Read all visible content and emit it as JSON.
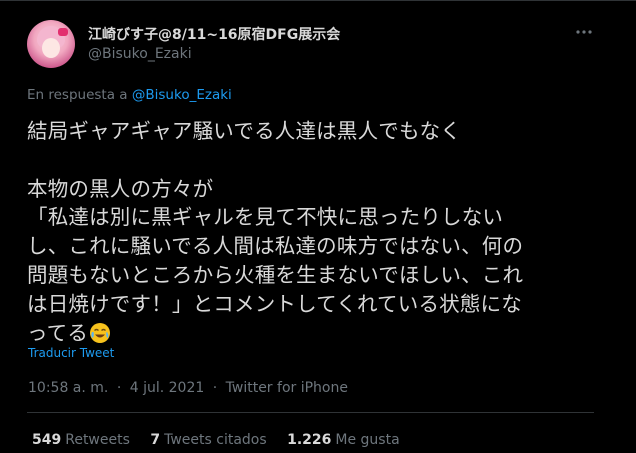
{
  "author": {
    "display_name": "江崎びす子@8/11~16原宿DFG展示会",
    "handle": "@Bisuko_Ezaki"
  },
  "reply": {
    "prefix": "En respuesta a",
    "mention": "@Bisuko_Ezaki"
  },
  "tweet": {
    "text": "結局ギャアギャア騒いでる人達は黒人でもなく\n\n本物の黒人の方々が\n「私達は別に黒ギャルを見て不快に思ったりしない\nし、これに騒いでる人間は私達の味方ではない、何の\n問題もないところから火種を生まないでほしい、これ\nは日焼けです！」とコメントしてくれている状態にな\nってる",
    "emoji": "face-with-tears-of-joy-icon"
  },
  "translate_label": "Traducir Tweet",
  "meta": {
    "time": "10:58 a. m.",
    "separator": "·",
    "date": "4 jul. 2021",
    "source": "Twitter for iPhone"
  },
  "stats": {
    "retweets_count": "549",
    "retweets_label": "Retweets",
    "quotes_count": "7",
    "quotes_label": "Tweets citados",
    "likes_count": "1.226",
    "likes_label": "Me gusta"
  },
  "colors": {
    "background": "#000000",
    "text": "#d9d9d9",
    "muted": "#6e767d",
    "accent": "#1d9bf0",
    "divider": "#2f3336"
  }
}
